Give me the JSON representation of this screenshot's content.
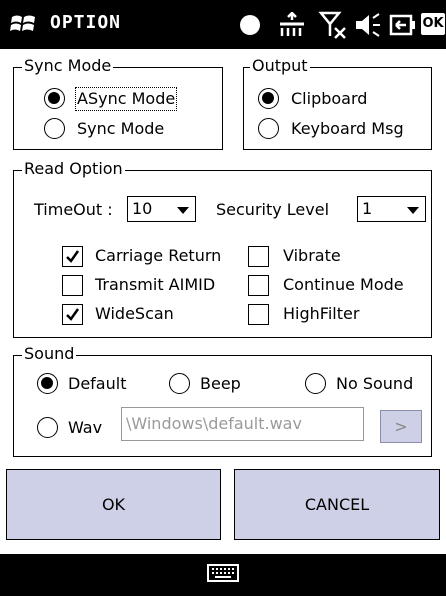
{
  "window": {
    "title": "OPTION",
    "ok_icon_text": "OK"
  },
  "sync_mode": {
    "legend": "Sync Mode",
    "options": [
      {
        "label": "ASync Mode",
        "selected": true
      },
      {
        "label": "Sync Mode",
        "selected": false
      }
    ]
  },
  "output": {
    "legend": "Output",
    "options": [
      {
        "label": "Clipboard",
        "selected": true
      },
      {
        "label": "Keyboard Msg",
        "selected": false
      }
    ]
  },
  "read_option": {
    "legend": "Read Option",
    "timeout_label": "TimeOut :",
    "timeout_value": "10",
    "security_label": "Security Level",
    "security_value": "1",
    "checks": [
      {
        "label": "Carriage Return",
        "checked": true
      },
      {
        "label": "Vibrate",
        "checked": false
      },
      {
        "label": "Transmit AIMID",
        "checked": false
      },
      {
        "label": "Continue Mode",
        "checked": false
      },
      {
        "label": "WideScan",
        "checked": true
      },
      {
        "label": "HighFilter",
        "checked": false
      }
    ]
  },
  "sound": {
    "legend": "Sound",
    "options": [
      {
        "label": "Default",
        "selected": true
      },
      {
        "label": "Beep",
        "selected": false
      },
      {
        "label": "No Sound",
        "selected": false
      },
      {
        "label": "Wav",
        "selected": false
      }
    ],
    "wav_path": "\\Windows\\default.wav",
    "browse_label": ">"
  },
  "buttons": {
    "ok": "OK",
    "cancel": "CANCEL"
  },
  "colors": {
    "button_bg": "#cdd0e6",
    "bar_bg": "#000000"
  }
}
